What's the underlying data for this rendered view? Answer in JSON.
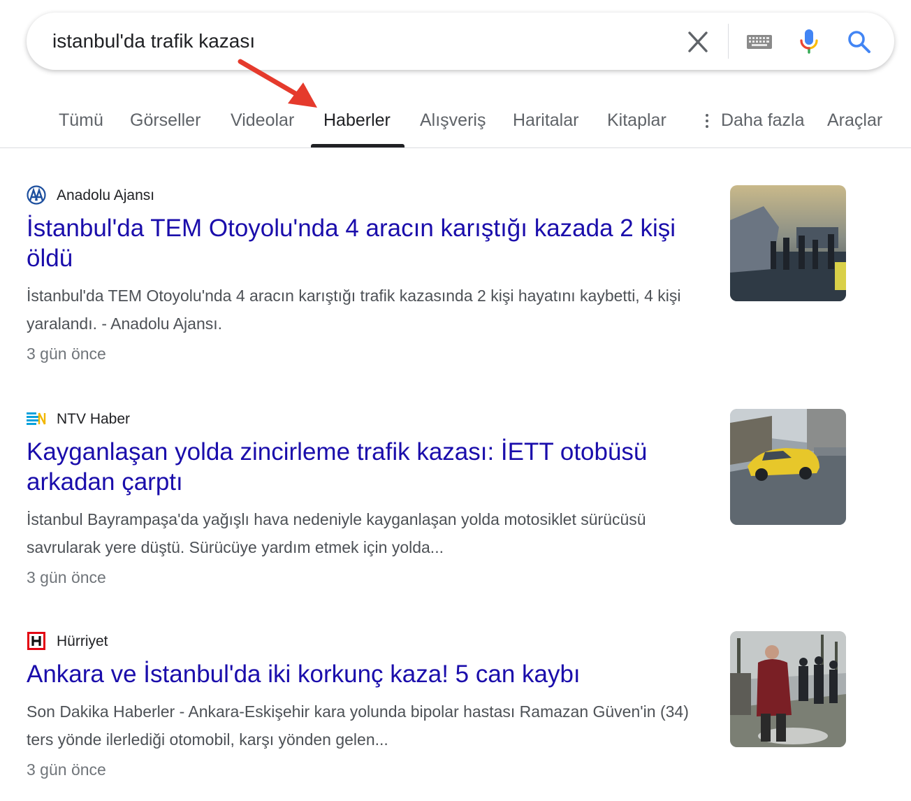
{
  "search": {
    "query": "istanbul'da trafik kazası",
    "clear_icon": "close-icon",
    "keyboard_icon": "keyboard-icon",
    "voice_icon": "microphone-icon",
    "search_icon": "search-icon"
  },
  "tabs": [
    {
      "label": "Tümü",
      "active": false
    },
    {
      "label": "Görseller",
      "active": false
    },
    {
      "label": "Videolar",
      "active": false
    },
    {
      "label": "Haberler",
      "active": true
    },
    {
      "label": "Alışveriş",
      "active": false
    },
    {
      "label": "Haritalar",
      "active": false
    },
    {
      "label": "Kitaplar",
      "active": false
    },
    {
      "label": "Daha fazla",
      "active": false
    },
    {
      "label": "Araçlar",
      "active": false
    }
  ],
  "colors": {
    "link": "#1a0dab",
    "snippet": "#4d5156",
    "muted": "#70757a",
    "arrow": "#e53a2c",
    "google_blue": "#4285f4",
    "google_red": "#ea4335",
    "google_yellow": "#fbbc05",
    "google_green": "#34a853"
  },
  "results": [
    {
      "source": "Anadolu Ajansı",
      "title": "İstanbul'da TEM Otoyolu'nda 4 aracın karıştığı kazada 2 kişi öldü",
      "snippet": "İstanbul'da TEM Otoyolu'nda 4 aracın karıştığı trafik kazasında 2 kişi hayatını kaybetti, 4 kişi yaralandı. - Anadolu Ajansı.",
      "time": "3 gün önce"
    },
    {
      "source": "NTV Haber",
      "title": "Kayganlaşan yolda zincirleme trafik kazası: İETT otobüsü arkadan çarptı",
      "snippet": "İstanbul Bayrampaşa'da yağışlı hava nedeniyle kayganlaşan yolda motosiklet sürücüsü savrularak yere düştü. Sürücüye yardım etmek için yolda...",
      "time": "3 gün önce"
    },
    {
      "source": "Hürriyet",
      "title": "Ankara ve İstanbul'da iki korkunç kaza! 5 can kaybı",
      "snippet": "Son Dakika Haberler - Ankara-Eskişehir kara yolunda bipolar hastası Ramazan Güven'in (34) ters yönde ilerlediği otomobil, karşı yönden gelen...",
      "time": "3 gün önce"
    }
  ]
}
